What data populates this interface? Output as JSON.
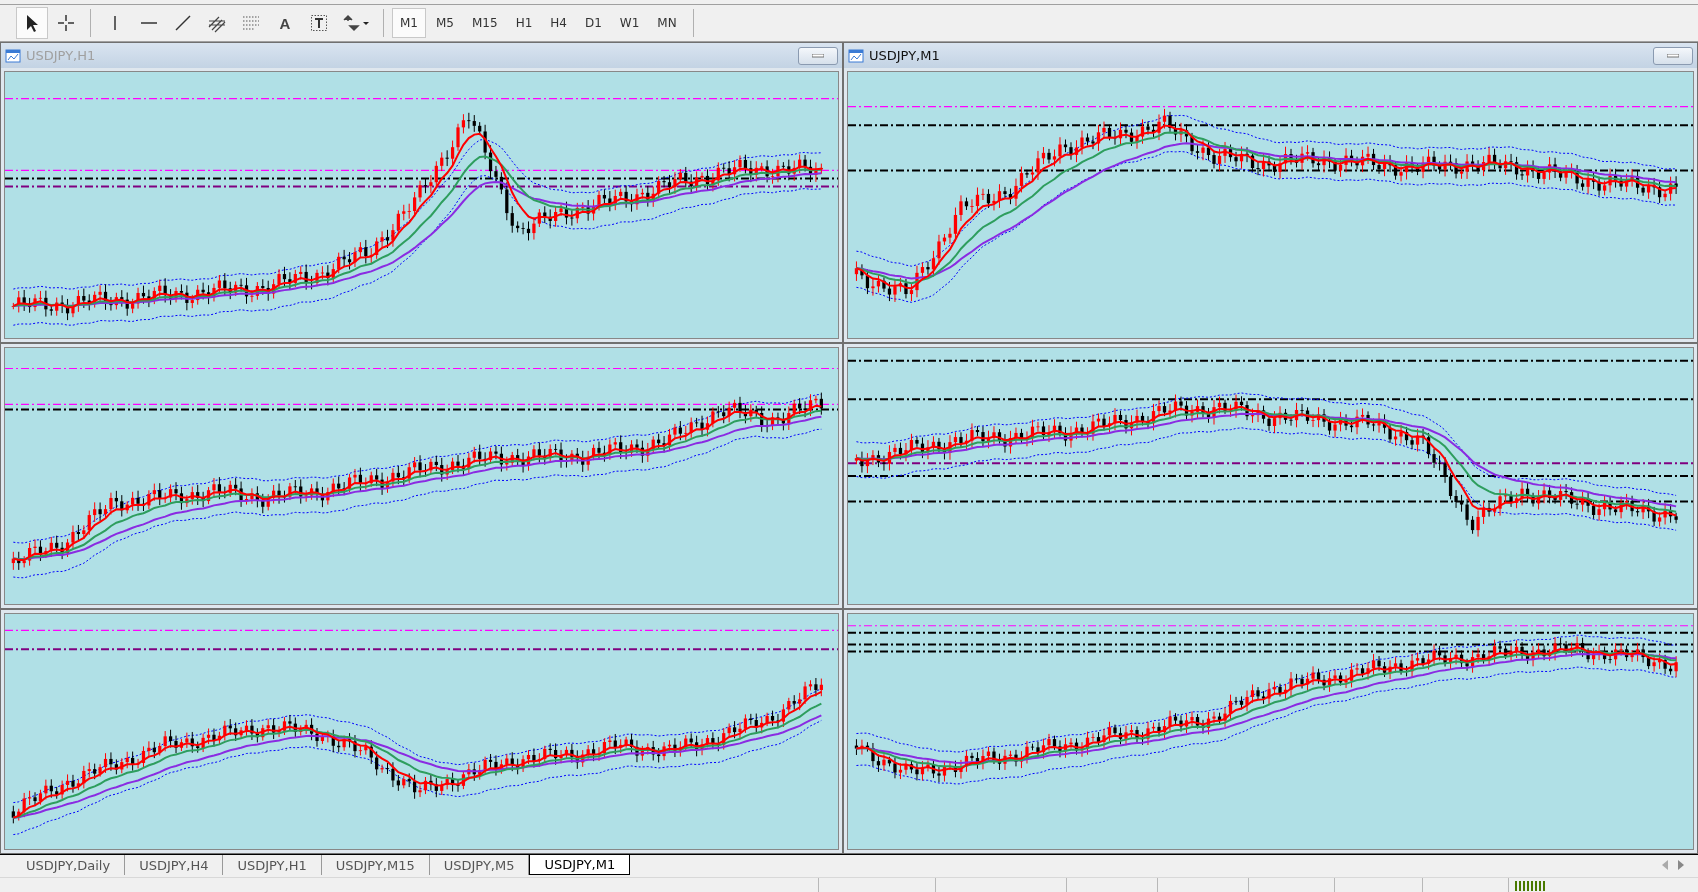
{
  "toolbar": {
    "tools": [
      {
        "kind": "cursor",
        "selected": true
      },
      {
        "kind": "crosshair",
        "selected": false
      },
      {
        "kind": "vline",
        "selected": false
      },
      {
        "kind": "hline",
        "selected": false
      },
      {
        "kind": "trendline",
        "selected": false
      },
      {
        "kind": "fibo-channel",
        "selected": false
      },
      {
        "kind": "fibo-levels",
        "selected": false
      },
      {
        "kind": "text",
        "label": "A",
        "selected": false
      },
      {
        "kind": "label",
        "selected": false
      },
      {
        "kind": "arrows",
        "selected": false
      }
    ],
    "timeframes": [
      {
        "label": "M1",
        "selected": true
      },
      {
        "label": "M5",
        "selected": false
      },
      {
        "label": "M15",
        "selected": false
      },
      {
        "label": "H1",
        "selected": false
      },
      {
        "label": "H4",
        "selected": false
      },
      {
        "label": "D1",
        "selected": false
      },
      {
        "label": "W1",
        "selected": false
      },
      {
        "label": "MN",
        "selected": false
      }
    ]
  },
  "charts": [
    {
      "kind": "chart",
      "title": "USDJPY,H1",
      "active": false
    },
    {
      "kind": "chart",
      "title": "USDJPY,M1",
      "active": true
    },
    {
      "kind": "chart"
    },
    {
      "kind": "chart"
    },
    {
      "kind": "chart"
    },
    {
      "kind": "chart"
    }
  ],
  "tabs": [
    {
      "label": "USDJPY,Daily",
      "selected": false
    },
    {
      "label": "USDJPY,H4",
      "selected": false
    },
    {
      "label": "USDJPY,H1",
      "selected": false
    },
    {
      "label": "USDJPY,M15",
      "selected": false
    },
    {
      "label": "USDJPY,M5",
      "selected": false
    },
    {
      "label": "USDJPY,M1",
      "selected": true
    }
  ]
}
